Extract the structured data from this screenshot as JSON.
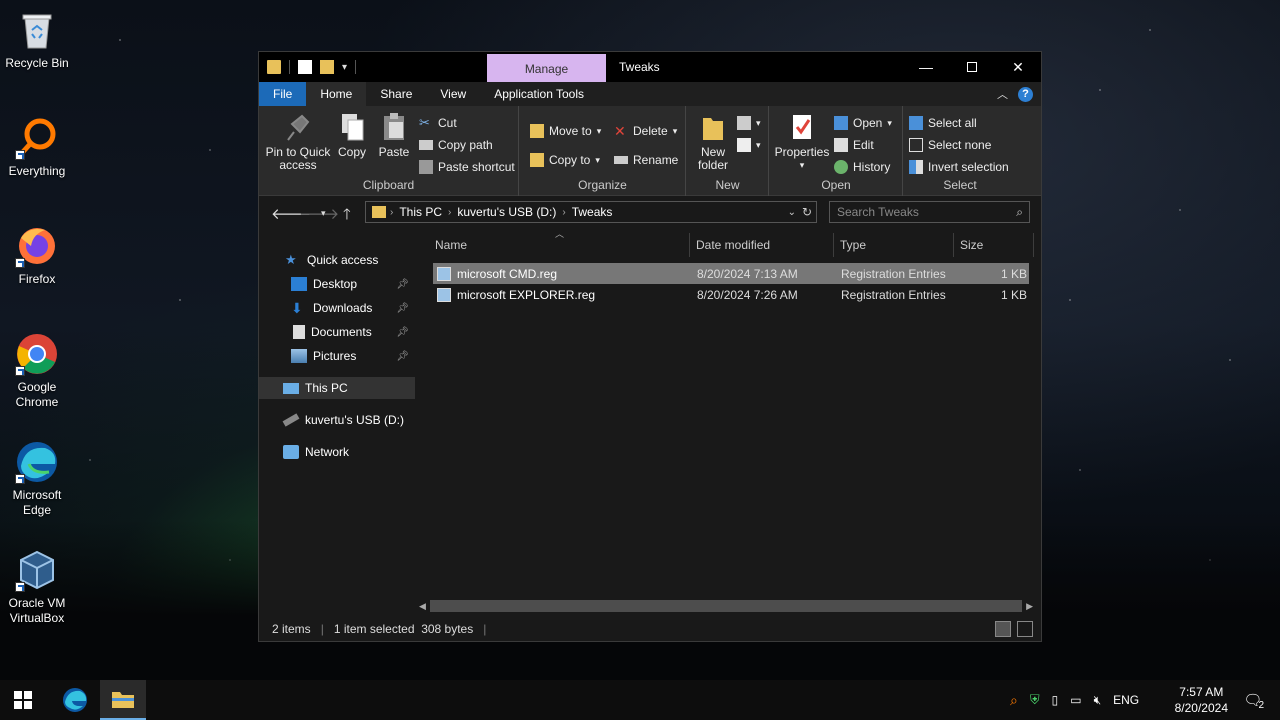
{
  "desktop": {
    "icons": [
      {
        "label": "Recycle Bin"
      },
      {
        "label": "Everything"
      },
      {
        "label": "Firefox"
      },
      {
        "label": "Google Chrome"
      },
      {
        "label": "Microsoft Edge"
      },
      {
        "label": "Oracle VM VirtualBox"
      }
    ]
  },
  "window": {
    "title": "Tweaks",
    "contextual_tab": "Manage",
    "tabs": {
      "file": "File",
      "home": "Home",
      "share": "Share",
      "view": "View",
      "app_tools": "Application Tools"
    },
    "ribbon": {
      "clipboard": {
        "label": "Clipboard",
        "pin": "Pin to Quick access",
        "copy": "Copy",
        "paste": "Paste",
        "cut": "Cut",
        "copy_path": "Copy path",
        "paste_shortcut": "Paste shortcut"
      },
      "organize": {
        "label": "Organize",
        "move_to": "Move to",
        "copy_to": "Copy to",
        "delete": "Delete",
        "rename": "Rename"
      },
      "new": {
        "label": "New",
        "new_folder": "New folder"
      },
      "open": {
        "label": "Open",
        "properties": "Properties",
        "open": "Open",
        "edit": "Edit",
        "history": "History"
      },
      "select": {
        "label": "Select",
        "select_all": "Select all",
        "select_none": "Select none",
        "invert": "Invert selection"
      }
    },
    "address": {
      "crumbs": [
        "This PC",
        "kuvertu's USB (D:)",
        "Tweaks"
      ]
    },
    "search": {
      "placeholder": "Search Tweaks"
    },
    "nav": {
      "quick_access": "Quick access",
      "desktop": "Desktop",
      "downloads": "Downloads",
      "documents": "Documents",
      "pictures": "Pictures",
      "this_pc": "This PC",
      "usb": "kuvertu's USB (D:)",
      "network": "Network"
    },
    "columns": {
      "name": "Name",
      "date": "Date modified",
      "type": "Type",
      "size": "Size"
    },
    "files": [
      {
        "name": "microsoft CMD.reg",
        "date": "8/20/2024 7:13 AM",
        "type": "Registration Entries",
        "size": "1 KB",
        "selected": true
      },
      {
        "name": "microsoft EXPLORER.reg",
        "date": "8/20/2024 7:26 AM",
        "type": "Registration Entries",
        "size": "1 KB",
        "selected": false
      }
    ],
    "status": {
      "items": "2 items",
      "selected": "1 item selected  308 bytes"
    }
  },
  "taskbar": {
    "language": "ENG",
    "time": "7:57 AM",
    "date": "8/20/2024",
    "notification_count": "2"
  },
  "colors": {
    "file_tab": "#1c6ab8",
    "manage_tab": "#d7b5ef",
    "selected_row": "#777777"
  }
}
